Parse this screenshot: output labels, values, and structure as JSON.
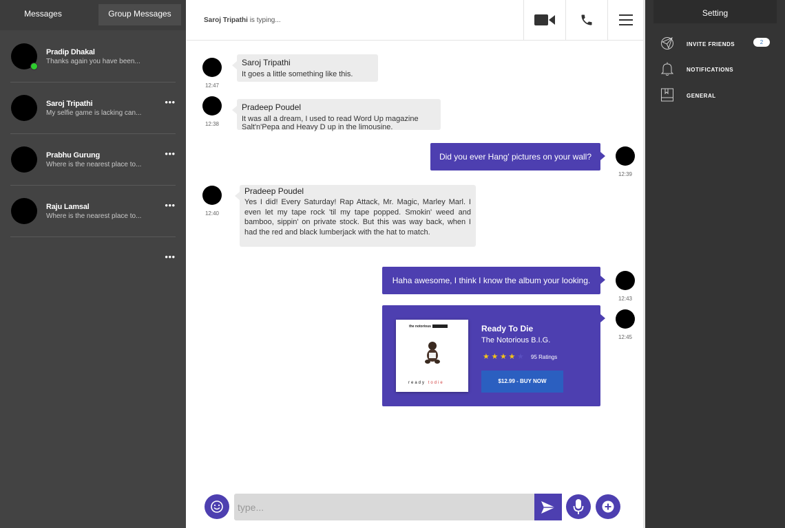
{
  "sidebar": {
    "tabs": [
      "Messages",
      "Group Messages"
    ],
    "contacts": [
      {
        "name": "Pradip Dhakal",
        "preview": "Thanks again you have been...",
        "online": true
      },
      {
        "name": "Saroj Tripathi",
        "preview": "My selfie game is lacking can..."
      },
      {
        "name": "Prabhu Gurung",
        "preview": "Where is the nearest place to..."
      },
      {
        "name": "Raju Lamsal",
        "preview": "Where is the nearest place to..."
      }
    ],
    "more_icon": "ellipsis-icon"
  },
  "header": {
    "typing_name": "Saroj Tripathi",
    "typing_suffix": "is typing...",
    "icons": [
      "video-camera-icon",
      "phone-icon",
      "hamburger-menu-icon"
    ]
  },
  "messages": [
    {
      "direction": "in",
      "sender": "Saroj Tripathi",
      "text": "It goes a little something like this.",
      "time": "12:47"
    },
    {
      "direction": "in",
      "sender": "Pradeep Poudel",
      "text": "It was all a dream, I used to read Word Up magazine Salt'n'Pepa and Heavy D up in the limousine.",
      "time": "12:38"
    },
    {
      "direction": "out",
      "text": "Did you ever Hang' pictures on your wall?",
      "time": "12:39"
    },
    {
      "direction": "in",
      "sender": "Pradeep Poudel",
      "text": "Yes I did! Every Saturday! Rap Attack, Mr. Magic, Marley Marl. I even let my tape rock 'til my tape popped. Smokin' weed and bamboo, sippin' on private stock.  But this was way back, when I had the red and black lumberjack with the hat to match.",
      "time": "12:40"
    },
    {
      "direction": "out",
      "text": "Haha awesome,  I think I know the album your looking.",
      "time": "12:43"
    },
    {
      "direction": "out",
      "type": "album",
      "time": "12:45"
    }
  ],
  "album": {
    "cover_top": "the notorious",
    "cover_bottom_a": "ready",
    "cover_bottom_b": "todie",
    "title": "Ready To Die",
    "artist": "The Notorious B.I.G.",
    "rating": 4,
    "rating_max": 5,
    "ratings_text": "95 Ratings",
    "buy_label": "$12.99  -  BUY NOW"
  },
  "composer": {
    "placeholder": "type...",
    "icons": [
      "emoji-icon",
      "send-icon",
      "microphone-icon",
      "plus-icon"
    ]
  },
  "settings": {
    "title": "Setting",
    "items": [
      {
        "label": "INVITE FRIENDS",
        "icon": "invite-icon",
        "badge": "2"
      },
      {
        "label": "NOTIFICATIONS",
        "icon": "bell-icon"
      },
      {
        "label": "GENERAL",
        "icon": "book-icon"
      }
    ]
  },
  "colors": {
    "accent": "#4d3fb0",
    "sidebar_bg": "#434343",
    "settings_bg": "#343434",
    "online": "#2ecc2e",
    "star": "#f5c518",
    "buy_button": "#2b5fc0"
  }
}
